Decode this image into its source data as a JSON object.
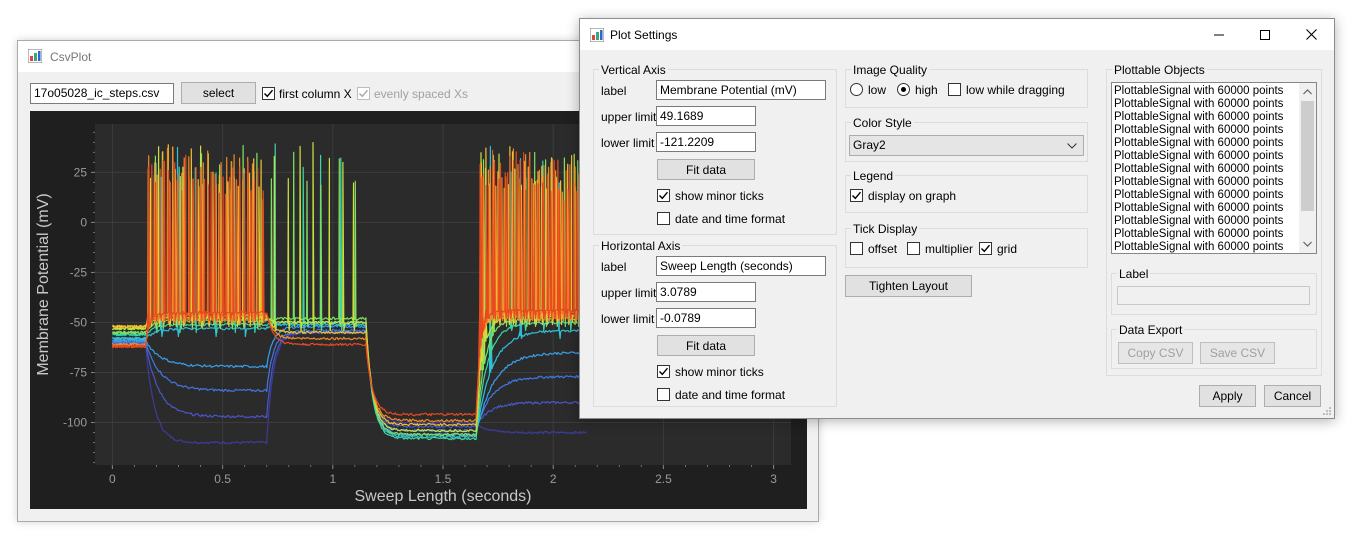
{
  "csvplot": {
    "title": "CsvPlot",
    "file_name": "17o05028_ic_steps.csv",
    "select_label": "select",
    "first_column_x_label": "first column X",
    "first_column_x_checked": true,
    "evenly_spaced_label": "evenly spaced Xs",
    "evenly_spaced_checked": true
  },
  "settings": {
    "title": "Plot Settings",
    "vertical": {
      "group": "Vertical Axis",
      "label_caption": "label",
      "label_value": "Membrane Potential (mV)",
      "upper_caption": "upper limit",
      "upper_value": "49.1689",
      "lower_caption": "lower limit",
      "lower_value": "-121.2209",
      "fit_label": "Fit data",
      "minor_ticks_label": "show minor ticks",
      "minor_ticks_checked": true,
      "date_format_label": "date and time format",
      "date_format_checked": false
    },
    "horizontal": {
      "group": "Horizontal Axis",
      "label_caption": "label",
      "label_value": "Sweep Length (seconds)",
      "upper_caption": "upper limit",
      "upper_value": "3.0789",
      "lower_caption": "lower limit",
      "lower_value": "-0.0789",
      "fit_label": "Fit data",
      "minor_ticks_label": "show minor ticks",
      "minor_ticks_checked": true,
      "date_format_label": "date and time format",
      "date_format_checked": false
    },
    "image_quality": {
      "group": "Image Quality",
      "low": "low",
      "high": "high",
      "selected": "high",
      "low_drag_label": "low while dragging",
      "low_drag_checked": false
    },
    "color_style": {
      "group": "Color Style",
      "value": "Gray2"
    },
    "legend": {
      "group": "Legend",
      "display_label": "display on graph",
      "display_checked": true
    },
    "tick_display": {
      "group": "Tick Display",
      "offset_label": "offset",
      "offset_checked": false,
      "multiplier_label": "multiplier",
      "multiplier_checked": false,
      "grid_label": "grid",
      "grid_checked": true
    },
    "tighten_label": "Tighten Layout",
    "plottables": {
      "group": "Plottable Objects",
      "items": [
        "PlottableSignal with 60000 points",
        "PlottableSignal with 60000 points",
        "PlottableSignal with 60000 points",
        "PlottableSignal with 60000 points",
        "PlottableSignal with 60000 points",
        "PlottableSignal with 60000 points",
        "PlottableSignal with 60000 points",
        "PlottableSignal with 60000 points",
        "PlottableSignal with 60000 points",
        "PlottableSignal with 60000 points",
        "PlottableSignal with 60000 points",
        "PlottableSignal with 60000 points",
        "PlottableSignal with 60000 points"
      ]
    },
    "label_group": {
      "group": "Label",
      "value": ""
    },
    "export": {
      "group": "Data Export",
      "copy_label": "Copy CSV",
      "save_label": "Save CSV"
    },
    "apply_label": "Apply",
    "cancel_label": "Cancel"
  },
  "chart_data": {
    "type": "line",
    "xlabel": "Sweep Length (seconds)",
    "ylabel": "Membrane Potential (mV)",
    "xlim": [
      -0.0789,
      3.0789
    ],
    "ylim": [
      -121.2209,
      49.1689
    ],
    "x_ticks": [
      0,
      0.5,
      1,
      1.5,
      2,
      2.5,
      3
    ],
    "x_tick_labels": [
      "0",
      "0.5",
      "1",
      "1.5",
      "2",
      "2.5",
      "3"
    ],
    "y_ticks": [
      25,
      0,
      -25,
      -50,
      -75,
      -100
    ],
    "y_tick_labels": [
      "25",
      "0",
      "-25",
      "-50",
      "-75",
      "-100"
    ],
    "grid": true,
    "background": "#2b2b2c",
    "figure_background": "#1f1f20",
    "series_colors": [
      "#3c3c9c",
      "#4a56c8",
      "#3f78e0",
      "#3a9ee8",
      "#30c0d8",
      "#3bd6a4",
      "#7fe060",
      "#c8e040",
      "#f0c030",
      "#f08828",
      "#e84a20"
    ],
    "series": [
      {
        "name": "",
        "steps": [
          {
            "x0": 0,
            "x1": 0.15,
            "v": -60
          },
          {
            "x0": 0.15,
            "x1": 0.7,
            "v": -110,
            "tau": 0.04
          },
          {
            "x0": 0.7,
            "x1": 1.15,
            "v": -55
          },
          {
            "x0": 1.15,
            "x1": 1.65,
            "v": -100
          },
          {
            "x0": 1.65,
            "x1": 2.15,
            "v": -105,
            "tau": 0.05
          }
        ]
      },
      {
        "name": "",
        "steps": [
          {
            "x0": 0,
            "x1": 0.15,
            "v": -60
          },
          {
            "x0": 0.15,
            "x1": 0.7,
            "v": -97,
            "tau": 0.06
          },
          {
            "x0": 0.7,
            "x1": 1.15,
            "v": -55
          },
          {
            "x0": 1.15,
            "x1": 1.65,
            "v": -102
          },
          {
            "x0": 1.65,
            "x1": 2.15,
            "v": -90,
            "tau": 0.06
          }
        ]
      },
      {
        "name": "",
        "steps": [
          {
            "x0": 0,
            "x1": 0.15,
            "v": -60
          },
          {
            "x0": 0.15,
            "x1": 0.7,
            "v": -84,
            "tau": 0.07
          },
          {
            "x0": 0.7,
            "x1": 1.15,
            "v": -54
          },
          {
            "x0": 1.15,
            "x1": 1.65,
            "v": -104
          },
          {
            "x0": 1.65,
            "x1": 2.15,
            "v": -77,
            "tau": 0.07
          }
        ]
      },
      {
        "name": "",
        "steps": [
          {
            "x0": 0,
            "x1": 0.15,
            "v": -59
          },
          {
            "x0": 0.15,
            "x1": 0.7,
            "v": -72,
            "tau": 0.07
          },
          {
            "x0": 0.7,
            "x1": 1.15,
            "v": -52
          },
          {
            "x0": 1.15,
            "x1": 1.65,
            "v": -106
          },
          {
            "x0": 1.65,
            "x1": 2.15,
            "v": -65,
            "tau": 0.08
          }
        ]
      },
      {
        "name": "",
        "steps": [
          {
            "x0": 0,
            "x1": 0.15,
            "v": -58
          },
          {
            "x0": 0.15,
            "x1": 0.7,
            "v": -53,
            "tau": 0.05,
            "spikes": 4
          },
          {
            "x0": 0.7,
            "x1": 1.15,
            "v": -51
          },
          {
            "x0": 1.15,
            "x1": 1.65,
            "v": -107
          },
          {
            "x0": 1.65,
            "x1": 2.15,
            "v": -54,
            "tau": 0.07,
            "spikes": 3
          }
        ]
      },
      {
        "name": "",
        "steps": [
          {
            "x0": 0,
            "x1": 0.15,
            "v": -56
          },
          {
            "x0": 0.15,
            "x1": 0.7,
            "v": -51,
            "tau": 0.04,
            "spikes": 6
          },
          {
            "x0": 0.7,
            "x1": 1.15,
            "v": -50,
            "spikes": 4
          },
          {
            "x0": 1.15,
            "x1": 1.65,
            "v": -108
          },
          {
            "x0": 1.65,
            "x1": 2.15,
            "v": -50,
            "tau": 0.05,
            "spikes": 5
          }
        ]
      },
      {
        "name": "",
        "steps": [
          {
            "x0": 0,
            "x1": 0.15,
            "v": -55
          },
          {
            "x0": 0.15,
            "x1": 0.7,
            "v": -49,
            "tau": 0.03,
            "spikes": 9
          },
          {
            "x0": 0.7,
            "x1": 1.15,
            "v": -48,
            "spikes": 6
          },
          {
            "x0": 1.15,
            "x1": 1.65,
            "v": -106
          },
          {
            "x0": 1.65,
            "x1": 2.15,
            "v": -48,
            "tau": 0.04,
            "spikes": 10
          }
        ]
      },
      {
        "name": "",
        "steps": [
          {
            "x0": 0,
            "x1": 0.15,
            "v": -53
          },
          {
            "x0": 0.15,
            "x1": 0.7,
            "v": -48,
            "tau": 0.02,
            "spikes": 14
          },
          {
            "x0": 0.7,
            "x1": 1.15,
            "v": -50,
            "spikes": 7
          },
          {
            "x0": 1.15,
            "x1": 1.65,
            "v": -104
          },
          {
            "x0": 1.65,
            "x1": 2.15,
            "v": -47,
            "tau": 0.03,
            "spikes": 16
          }
        ]
      },
      {
        "name": "",
        "steps": [
          {
            "x0": 0,
            "x1": 0.15,
            "v": -52
          },
          {
            "x0": 0.15,
            "x1": 0.7,
            "v": -47,
            "tau": 0.02,
            "spikes": 20
          },
          {
            "x0": 0.7,
            "x1": 1.15,
            "v": -55
          },
          {
            "x0": 1.15,
            "x1": 1.65,
            "v": -101
          },
          {
            "x0": 1.65,
            "x1": 2.15,
            "v": -46,
            "tau": 0.02,
            "spikes": 22
          }
        ]
      },
      {
        "name": "",
        "steps": [
          {
            "x0": 0,
            "x1": 0.15,
            "v": -61
          },
          {
            "x0": 0.15,
            "x1": 0.7,
            "v": -46,
            "tau": 0.02,
            "spikes": 26
          },
          {
            "x0": 0.7,
            "x1": 1.15,
            "v": -58
          },
          {
            "x0": 1.15,
            "x1": 1.65,
            "v": -99
          },
          {
            "x0": 1.65,
            "x1": 2.15,
            "v": -45,
            "tau": 0.02,
            "spikes": 28
          }
        ]
      },
      {
        "name": "",
        "steps": [
          {
            "x0": 0,
            "x1": 0.15,
            "v": -62
          },
          {
            "x0": 0.15,
            "x1": 0.7,
            "v": -45,
            "tau": 0.02,
            "spikes": 32
          },
          {
            "x0": 0.7,
            "x1": 1.15,
            "v": -61
          },
          {
            "x0": 1.15,
            "x1": 1.65,
            "v": -96
          },
          {
            "x0": 1.65,
            "x1": 2.15,
            "v": -44,
            "tau": 0.02,
            "spikes": 34
          }
        ]
      }
    ]
  }
}
